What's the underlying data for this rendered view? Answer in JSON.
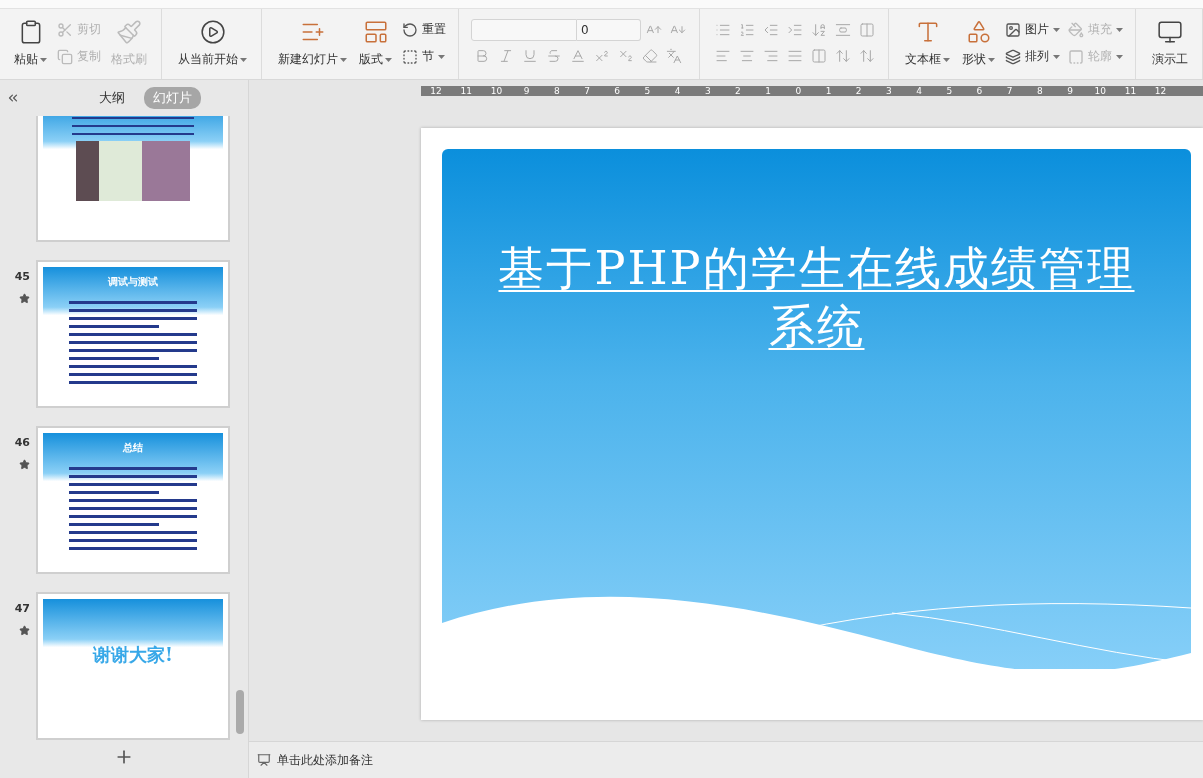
{
  "ribbon": {
    "groups": [
      {
        "items": [
          {
            "kind": "large",
            "label": "粘贴",
            "dropdown": true,
            "disabled": false
          },
          {
            "kind": "small",
            "label": "剪切",
            "dropdown": false,
            "disabled": true
          },
          {
            "kind": "small",
            "label": "复制",
            "dropdown": false,
            "disabled": true
          },
          {
            "kind": "large",
            "label": "格式刷",
            "dropdown": false,
            "disabled": true
          }
        ]
      },
      {
        "items": [
          {
            "kind": "large",
            "label": "从当前开始",
            "dropdown": true,
            "disabled": false
          }
        ]
      },
      {
        "items": [
          {
            "kind": "large",
            "label": "新建幻灯片",
            "dropdown": true,
            "disabled": false
          },
          {
            "kind": "large",
            "label": "版式",
            "dropdown": true,
            "disabled": false
          },
          {
            "kind": "small",
            "label": "重置",
            "dropdown": false,
            "disabled": false
          },
          {
            "kind": "small",
            "label": "节",
            "dropdown": true,
            "disabled": false
          }
        ]
      },
      {
        "kind": "font",
        "font_size": "0"
      },
      {
        "kind": "paragraph"
      },
      {
        "items": [
          {
            "kind": "large",
            "label": "文本框",
            "dropdown": true,
            "disabled": false
          },
          {
            "kind": "large",
            "label": "形状",
            "dropdown": true,
            "disabled": false
          },
          {
            "kind": "small",
            "label": "图片",
            "dropdown": true,
            "disabled": false
          },
          {
            "kind": "small",
            "label": "排列",
            "dropdown": true,
            "disabled": false
          },
          {
            "kind": "small",
            "label": "填充",
            "dropdown": true,
            "disabled": true
          },
          {
            "kind": "small",
            "label": "轮廓",
            "dropdown": true,
            "disabled": true
          }
        ]
      },
      {
        "items": [
          {
            "kind": "large",
            "label": "演示工",
            "dropdown": false,
            "disabled": false
          }
        ]
      }
    ]
  },
  "panel": {
    "tabs": [
      {
        "label": "大纲",
        "selected": false
      },
      {
        "label": "幻灯片",
        "selected": true
      }
    ],
    "slides": [
      {
        "kind": "screenshot"
      },
      {
        "number": "45",
        "kind": "text",
        "title": "调试与测试"
      },
      {
        "number": "46",
        "kind": "text",
        "title": "总结"
      },
      {
        "number": "47",
        "kind": "thanks",
        "title": "谢谢大家!"
      }
    ]
  },
  "ruler": [
    "12",
    "11",
    "10",
    "9",
    "8",
    "7",
    "6",
    "5",
    "4",
    "3",
    "2",
    "1",
    "0",
    "1",
    "2",
    "3",
    "4",
    "5",
    "6",
    "7",
    "8",
    "9",
    "10",
    "11",
    "12"
  ],
  "slide": {
    "title": "基于PHP的学生在线成绩管理系统"
  },
  "notes": {
    "placeholder": "单击此处添加备注"
  }
}
